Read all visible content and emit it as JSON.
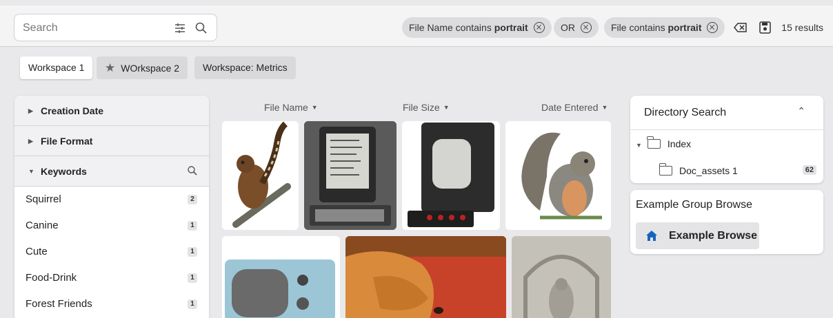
{
  "search": {
    "placeholder": "Search"
  },
  "filters": [
    {
      "prefix": "File Name contains ",
      "term": "portrait"
    },
    {
      "prefix": "OR",
      "term": ""
    },
    {
      "prefix": "File contains ",
      "term": "portrait"
    }
  ],
  "results_label": "15 results",
  "workspaces": [
    {
      "label": "Workspace 1",
      "active": true
    },
    {
      "label": "WOrkspace 2",
      "starred": true
    },
    {
      "label": "Workspace: Metrics"
    }
  ],
  "facets": [
    {
      "label": "Creation Date",
      "expanded": false
    },
    {
      "label": "File Format",
      "expanded": false
    },
    {
      "label": "Keywords",
      "expanded": true
    }
  ],
  "keywords": [
    {
      "label": "Squirrel",
      "count": "2"
    },
    {
      "label": "Canine",
      "count": "1"
    },
    {
      "label": "Cute",
      "count": "1"
    },
    {
      "label": "Food-Drink",
      "count": "1"
    },
    {
      "label": "Forest Friends",
      "count": "1"
    }
  ],
  "columns": [
    {
      "label": "File Name"
    },
    {
      "label": "File Size"
    },
    {
      "label": "Date Entered"
    }
  ],
  "thumbnails": [
    {
      "subject": "lemur-illustration"
    },
    {
      "subject": "vintage-computer-terminal"
    },
    {
      "subject": "vectrex-console"
    },
    {
      "subject": "squirrel-illustration"
    },
    {
      "subject": "blue-microwave"
    },
    {
      "subject": "sleeping-dog"
    },
    {
      "subject": "stone-carving"
    }
  ],
  "directory": {
    "title": "Directory Search",
    "root": "Index",
    "child": "Doc_assets 1",
    "child_count": "62"
  },
  "group_browse": {
    "title": "Example Group Browse",
    "button_label": "Example Browse"
  },
  "colors": {
    "accent": "#1565c0",
    "chip_bg": "#dcdcdf",
    "panel_bg": "#ffffff"
  }
}
